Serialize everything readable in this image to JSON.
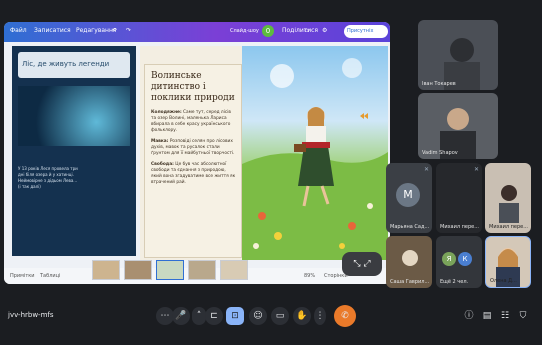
{
  "editor": {
    "menu_file": "Файл",
    "menu_main": "Записатися",
    "menu_edit": "Редагування",
    "slideshow": "Слайд-шоу",
    "share_label": "Поділитися",
    "presenter": "Присутніх"
  },
  "slides": {
    "left_title": "Ліс, де живуть легенди",
    "left_body": "У 13 років Леся провела три дні біля озера й у хатинці. Неймовірне з дідьом Лева... (і так далі)",
    "main_title": "Волинське дитинство і поклики природи",
    "para1_head": "Колодяжне:",
    "para1_text": "Саме тут, серед лісів та озер Волині, маленька Лариса вбирала в себе красу українського фольклору.",
    "para2_head": "Мавка:",
    "para2_text": "Розповіді селян про лісових духів, мавок та русалок стали ґрунтом для її майбутньої творчості.",
    "para3_head": "Свобода:",
    "para3_text": "Це був час абсолютної свободи та єднання з природою, який вона згадуватиме все життя як втрачений рай."
  },
  "bottom": {
    "notes_label": "Примітки",
    "tabs_label": "Таблиці",
    "zoom_label": "89%",
    "pages_label": "Сторінки"
  },
  "participants": [
    {
      "name": "Іван Токарев"
    },
    {
      "name": "Vadim Shapov"
    },
    {
      "name": "Марьяна Сад..."
    },
    {
      "name": "Михаил пере..."
    },
    {
      "name": "Саша Гаврил..."
    },
    {
      "name": "Ещё 2 чел."
    },
    {
      "name": "Олена Д..."
    }
  ],
  "avatars": {
    "letter_m": "М",
    "letter_e": "Я",
    "letter_k": "К"
  },
  "meeting": {
    "code": "jvv-hrbw-mfs"
  },
  "colors": {
    "accent": "#2f6fd3",
    "end_call": "#ea7a2a",
    "active": "#8ab4f8"
  }
}
